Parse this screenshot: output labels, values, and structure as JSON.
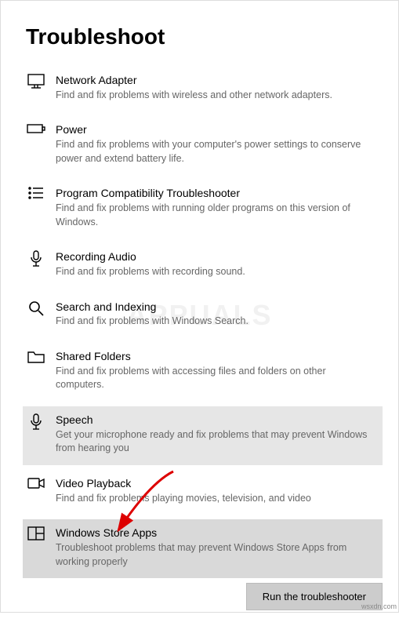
{
  "page": {
    "title": "Troubleshoot"
  },
  "items": [
    {
      "title": "Network Adapter",
      "desc": "Find and fix problems with wireless and other network adapters."
    },
    {
      "title": "Power",
      "desc": "Find and fix problems with your computer's power settings to conserve power and extend battery life."
    },
    {
      "title": "Program Compatibility Troubleshooter",
      "desc": "Find and fix problems with running older programs on this version of Windows."
    },
    {
      "title": "Recording Audio",
      "desc": "Find and fix problems with recording sound."
    },
    {
      "title": "Search and Indexing",
      "desc": "Find and fix problems with Windows Search."
    },
    {
      "title": "Shared Folders",
      "desc": "Find and fix problems with accessing files and folders on other computers."
    },
    {
      "title": "Speech",
      "desc": "Get your microphone ready and fix problems that may prevent Windows from hearing you"
    },
    {
      "title": "Video Playback",
      "desc": "Find and fix problems playing movies, television, and video"
    },
    {
      "title": "Windows Store Apps",
      "desc": "Troubleshoot problems that may prevent Windows Store Apps from working properly"
    }
  ],
  "button": {
    "run": "Run the troubleshooter"
  },
  "watermark": "APPUALS",
  "credit": "wsxdn.com"
}
